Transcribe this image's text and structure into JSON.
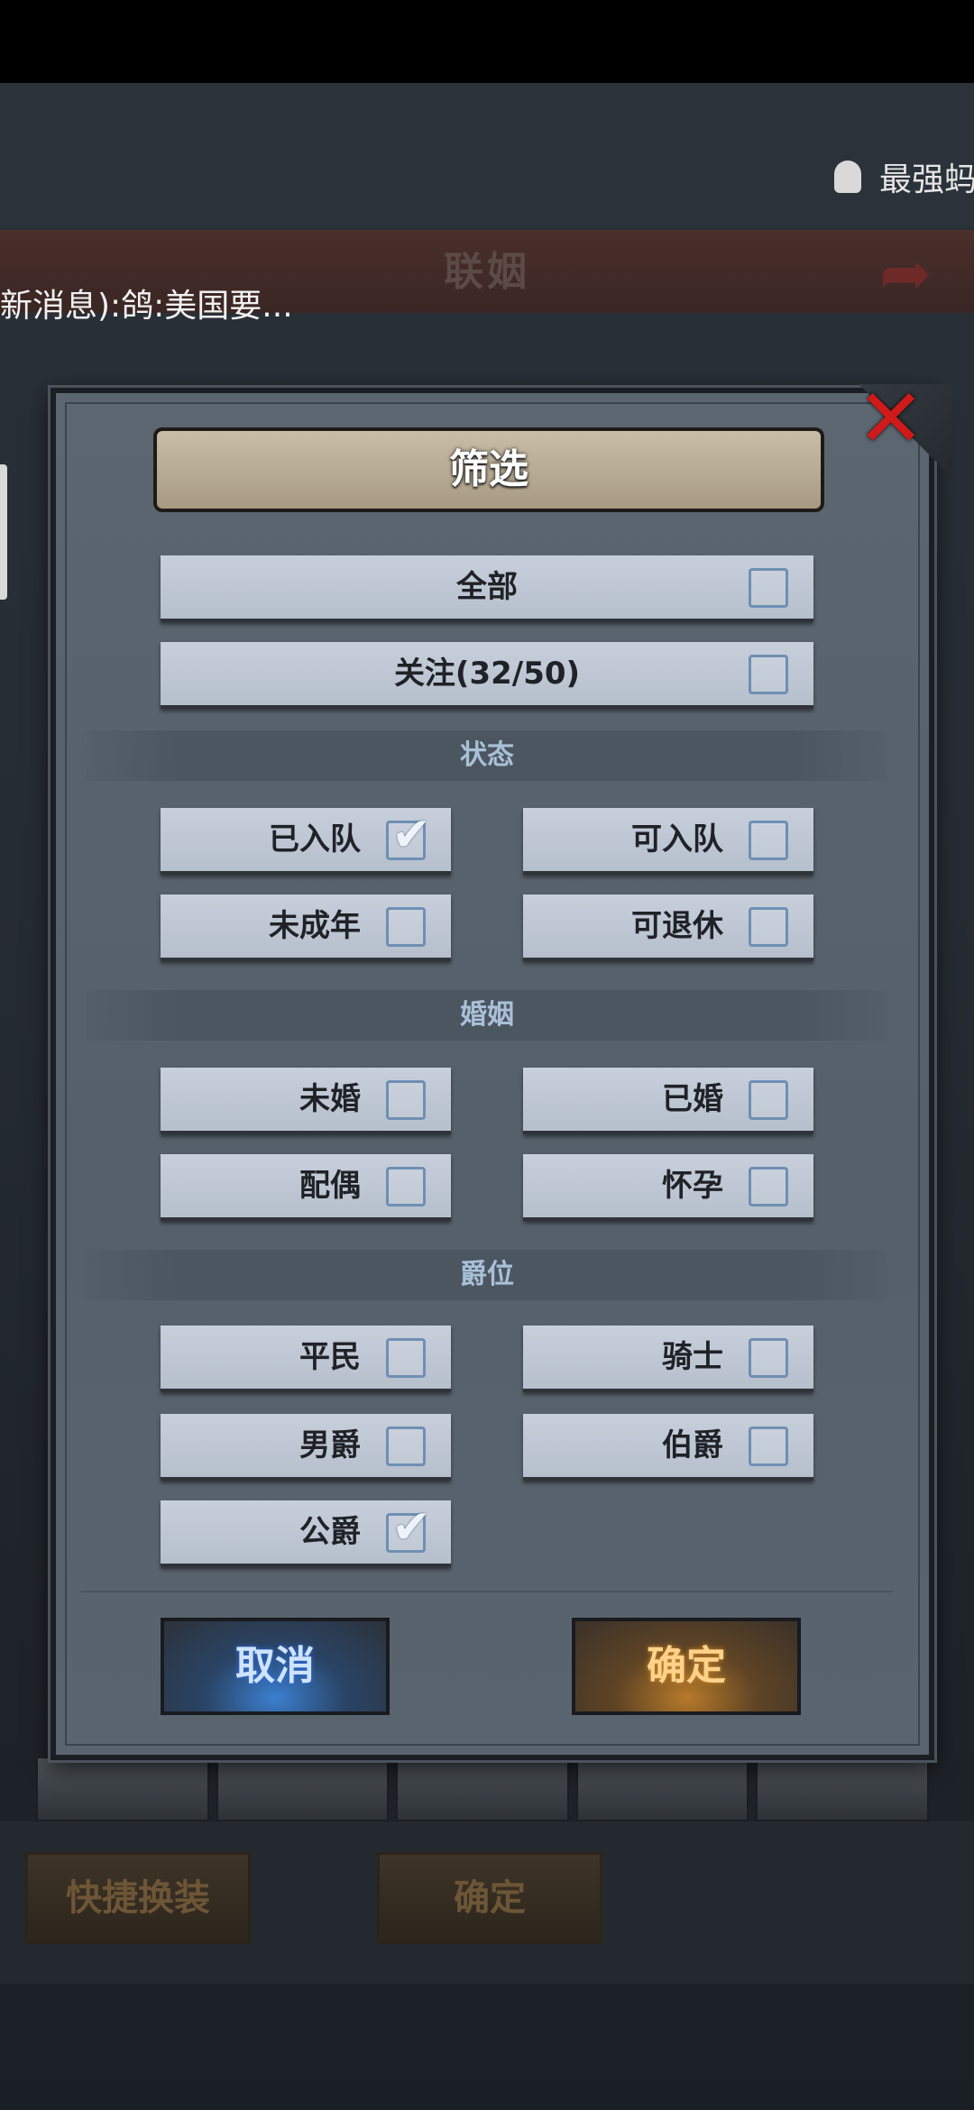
{
  "background": {
    "title": "联姻",
    "user_name": "最强蚂",
    "chat_message": "新消息):鸽:美国要...",
    "quick_change_label": "快捷换装",
    "confirm_label": "确定"
  },
  "dialog": {
    "title": "筛选",
    "options_top": [
      {
        "label": "全部",
        "checked": false
      },
      {
        "label": "关注(32/50)",
        "checked": false
      }
    ],
    "sections": [
      {
        "title": "状态",
        "options": [
          {
            "label": "已入队",
            "checked": true
          },
          {
            "label": "可入队",
            "checked": false
          },
          {
            "label": "未成年",
            "checked": false
          },
          {
            "label": "可退休",
            "checked": false
          }
        ]
      },
      {
        "title": "婚姻",
        "options": [
          {
            "label": "未婚",
            "checked": false
          },
          {
            "label": "已婚",
            "checked": false
          },
          {
            "label": "配偶",
            "checked": false
          },
          {
            "label": "怀孕",
            "checked": false
          }
        ]
      },
      {
        "title": "爵位",
        "options": [
          {
            "label": "平民",
            "checked": false
          },
          {
            "label": "骑士",
            "checked": false
          },
          {
            "label": "男爵",
            "checked": false
          },
          {
            "label": "伯爵",
            "checked": false
          },
          {
            "label": "公爵",
            "checked": true
          }
        ]
      }
    ],
    "cancel_label": "取消",
    "ok_label": "确定",
    "check_glyph": "✔"
  }
}
